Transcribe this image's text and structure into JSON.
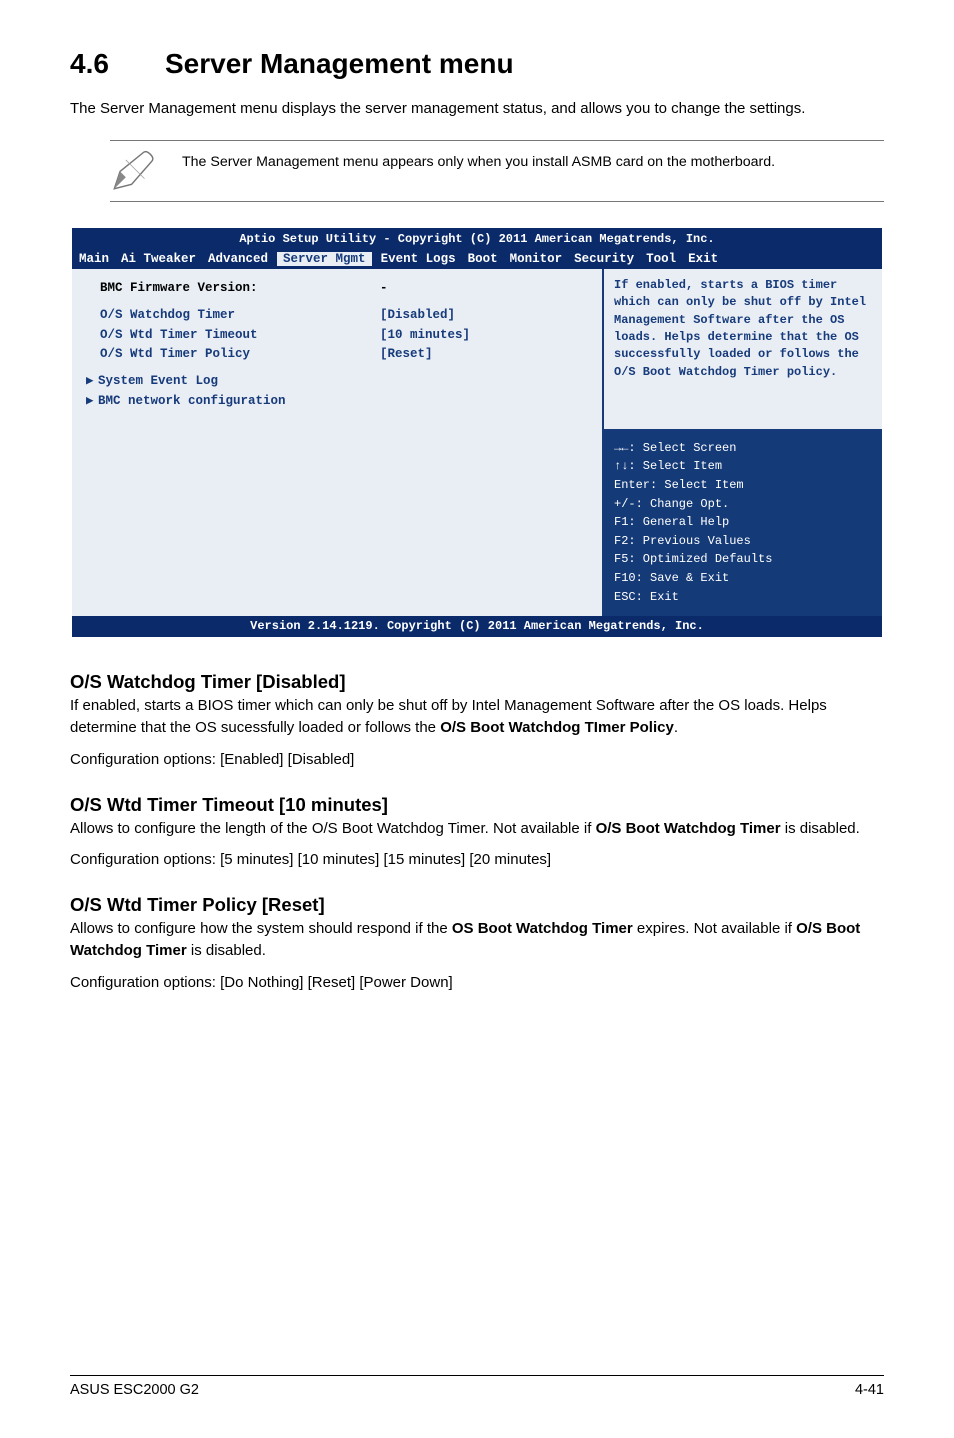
{
  "title_num": "4.6",
  "title_text": "Server Management menu",
  "intro": "The Server Management menu displays the server management status, and allows you to change the settings.",
  "note": "The Server Management menu appears only when you install ASMB card on the motherboard.",
  "bios": {
    "header": "Aptio Setup Utility - Copyright (C) 2011 American Megatrends, Inc.",
    "menubar": [
      "Main",
      "Ai Tweaker",
      "Advanced",
      "Server Mgmt",
      "Event Logs",
      "Boot",
      "Monitor",
      "Security",
      "Tool",
      "Exit"
    ],
    "menubar_selected": "Server Mgmt",
    "left": {
      "bmc_label": "BMC Firmware Version:",
      "bmc_value": "-",
      "r1_label": "O/S Watchdog Timer",
      "r1_value": "[Disabled]",
      "r2_label": "O/S Wtd Timer Timeout",
      "r2_value": "[10 minutes]",
      "r3_label": "O/S Wtd Timer Policy",
      "r3_value": "[Reset]",
      "sub1": "System Event Log",
      "sub2": "BMC network configuration"
    },
    "help": "If enabled, starts a BIOS timer which can only be shut off by Intel Management Software after the OS loads. Helps determine that the OS successfully loaded or follows the O/S Boot Watchdog Timer policy.",
    "keys": {
      "l1": "→←: Select Screen",
      "l2": "↑↓:  Select Item",
      "l3": "Enter: Select Item",
      "l4": "+/-: Change Opt.",
      "l5": "F1: General Help",
      "l6": "F2: Previous Values",
      "l7": "F5: Optimized Defaults",
      "l8": "F10: Save & Exit",
      "l9": "ESC: Exit"
    },
    "footer": "Version 2.14.1219. Copyright (C) 2011 American Megatrends, Inc."
  },
  "sections": [
    {
      "heading": "O/S Watchdog Timer [Disabled]",
      "body_pre": "If enabled, starts a BIOS timer which can only be shut off by Intel Management Software after the OS loads. Helps determine that the OS sucessfully loaded or follows the ",
      "body_bold": "O/S Boot Watchdog TImer Policy",
      "body_post": ".",
      "opts": "Configuration options: [Enabled] [Disabled]"
    },
    {
      "heading": "O/S Wtd Timer Timeout [10 minutes]",
      "body_pre": "Allows to configure the length of the O/S Boot Watchdog Timer. Not available if ",
      "body_bold": "O/S Boot Watchdog Timer",
      "body_post": " is disabled.",
      "opts": "Configuration options: [5 minutes] [10 minutes] [15 minutes] [20 minutes]"
    },
    {
      "heading": "O/S Wtd Timer Policy [Reset]",
      "body_pre": "Allows to configure how the system should respond if the ",
      "body_bold": "OS Boot Watchdog Timer",
      "body_post": " expires. Not available if ",
      "body_bold2": "O/S Boot Watchdog Timer",
      "body_post2": " is disabled.",
      "opts": "Configuration options: [Do Nothing] [Reset] [Power Down]"
    }
  ],
  "footer_left": "ASUS ESC2000 G2",
  "footer_right": "4-41"
}
